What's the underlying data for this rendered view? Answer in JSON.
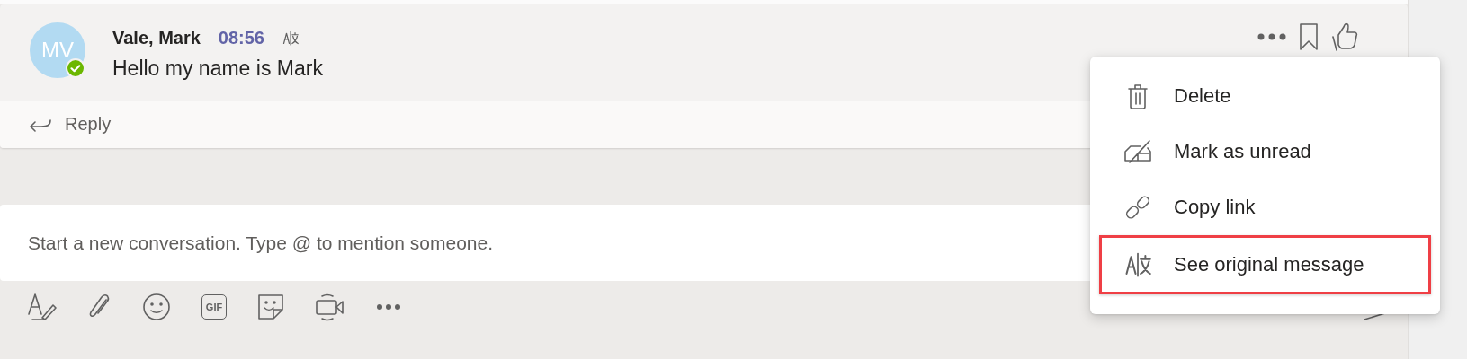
{
  "message": {
    "initials": "MV",
    "available": true,
    "author": "Vale, Mark",
    "time": "08:56",
    "translated": true,
    "text": "Hello my name is Mark"
  },
  "reply": {
    "label": "Reply"
  },
  "compose": {
    "placeholder": "Start a new conversation. Type @ to mention someone."
  },
  "toolbar": {
    "gif_label": "GIF"
  },
  "context_menu": {
    "items": [
      {
        "kind": "delete",
        "label": "Delete",
        "highlighted": false
      },
      {
        "kind": "unread",
        "label": "Mark as unread",
        "highlighted": false
      },
      {
        "kind": "link",
        "label": "Copy link",
        "highlighted": false
      },
      {
        "kind": "translate",
        "label": "See original message",
        "highlighted": true
      }
    ]
  }
}
